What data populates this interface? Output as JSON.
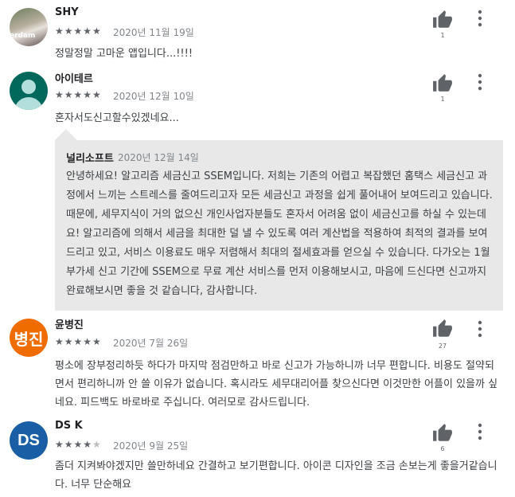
{
  "reviews": [
    {
      "name": "SHY",
      "stars": "★★★★★",
      "stars_empty": "",
      "rating": 5,
      "date": "2020년 11월 19일",
      "likes": "1",
      "body": "정말정말 고마운 앱입니다...!!!!",
      "avatar_text": "erdam"
    },
    {
      "name": "아이테르",
      "stars": "★★★★★",
      "stars_empty": "",
      "rating": 5,
      "date": "2020년 12월 10일",
      "likes": "1",
      "body": "혼자서도신고할수있겠네요..."
    },
    {
      "name": "윤병진",
      "stars": "★★★★★",
      "stars_empty": "",
      "rating": 5,
      "date": "2020년 7월 26일",
      "likes": "27",
      "body": "평소에 장부정리하듯 하다가 마지막 점검만하고 바로 신고가 가능하니까 너무 편합니다. 비용도 절약되면서 편리하니까 안 쓸 이유가 없습니다. 혹시라도 세무대리어플 찾으신다면 이것만한 어플이 있을까 싶네요. 피드백도 바로바로 주십니다. 여러모로 감사드립니다.",
      "avatar_text": "병진",
      "avatar_color": "#ef6c00"
    },
    {
      "name": "DS K",
      "stars": "★★★★",
      "stars_empty": "★",
      "rating": 4,
      "date": "2020년 9월 25일",
      "likes": "6",
      "body": "좀더 지켜봐야겠지만 쓸만하네요 간결하고 보기편합니다. 아이콘 디자인을 조금 손보는게 좋을거같습니다. 너무 단순해요",
      "avatar_text": "DS",
      "avatar_color": "#1a5fa6"
    }
  ],
  "reply": {
    "name": "널리소프트",
    "date": "2020년 12월 14일",
    "body": "안녕하세요! 알고리즘 세금신고 SSEM입니다. 저희는 기존의 어렵고 복잡했던 홈택스 세금신고 과정에서 느끼는 스트레스를 줄여드리고자 모든 세금신고 과정을 쉽게 풀어내어 보여드리고 있습니다. 때문에, 세무지식이 거의 없으신 개인사업자분들도 혼자서 어려움 없이 세금신고를 하실 수 있는데요! 알고리즘에 의해서 세금을 최대한 덜 낼 수 있도록 여러 계산법을 적용하여 최적의 결과를 보여드리고 있고, 서비스 이용료도 매우 저렴해서 최대의 절세효과를 얻으실 수 있습니다. 다가오는 1월 부가세 신고 기간에 SSEM으로 무료 계산 서비스를 먼저 이용해보시고, 마음에 드신다면 신고까지 완료해보시면 좋을 것 같습니다, 감사합니다."
  },
  "icons": {
    "like": "thumb-up-icon",
    "more": "more-vert-icon"
  },
  "colors": {
    "reply_bg": "#e8e8e8",
    "star": "#5f6368",
    "muted": "#80868b",
    "teal": "#00695c",
    "orange": "#ef6c00",
    "blue": "#1a5fa6"
  }
}
